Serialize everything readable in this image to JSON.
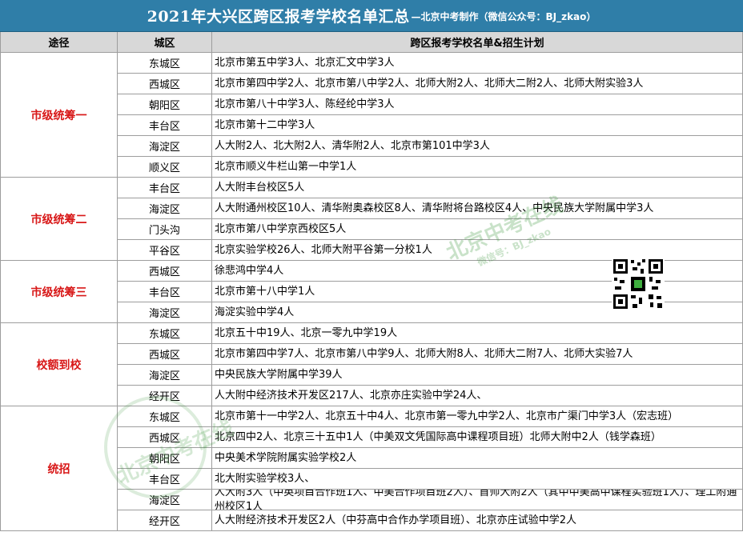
{
  "title": {
    "main": "2021年大兴区跨区报考学校名单汇总",
    "sub": "—北京中考制作（微信公众号：BJ_zkao）"
  },
  "headers": {
    "route": "途径",
    "district": "城区",
    "list": "跨区报考学校名单&招生计划"
  },
  "groups": [
    {
      "route": "市级统筹一",
      "rows": [
        {
          "district": "东城区",
          "schools": "北京市第五中学3人、北京汇文中学3人"
        },
        {
          "district": "西城区",
          "schools": "北京市第四中学2人、北京市第八中学2人、北师大附2人、北师大二附2人、北师大附实验3人"
        },
        {
          "district": "朝阳区",
          "schools": "北京市第八十中学3人、陈经纶中学3人"
        },
        {
          "district": "丰台区",
          "schools": "北京市第十二中学3人"
        },
        {
          "district": "海淀区",
          "schools": "人大附2人、北大附2人、清华附2人、北京市第101中学3人"
        },
        {
          "district": "顺义区",
          "schools": "北京市顺义牛栏山第一中学1人"
        }
      ]
    },
    {
      "route": "市级统筹二",
      "rows": [
        {
          "district": "丰台区",
          "schools": "人大附丰台校区5人"
        },
        {
          "district": "海淀区",
          "schools": "人大附通州校区10人、清华附奥森校区8人、清华附将台路校区4人、中央民族大学附属中学3人"
        },
        {
          "district": "门头沟",
          "schools": "北京市第八中学京西校区5人"
        },
        {
          "district": "平谷区",
          "schools": "北京实验学校26人、北师大附平谷第一分校1人"
        }
      ]
    },
    {
      "route": "市级统筹三",
      "rows": [
        {
          "district": "西城区",
          "schools": "徐悲鸿中学4人"
        },
        {
          "district": "丰台区",
          "schools": "北京市第十八中学1人"
        },
        {
          "district": "海淀区",
          "schools": "海淀实验中学4人"
        }
      ]
    },
    {
      "route": "校额到校",
      "rows": [
        {
          "district": "东城区",
          "schools": "北京五十中19人、北京一零九中学19人"
        },
        {
          "district": "西城区",
          "schools": "北京市第四中学7人、北京市第八中学9人、北师大附8人、北师大二附7人、北师大实验7人"
        },
        {
          "district": "海淀区",
          "schools": "中央民族大学附属中学39人"
        },
        {
          "district": "经开区",
          "schools": "人大附中经济技术开发区217人、北京亦庄实验中学24人、"
        }
      ]
    },
    {
      "route": "统招",
      "rows": [
        {
          "district": "东城区",
          "schools": "北京市第十一中学2人、北京五十中4人、北京市第一零九中学2人、北京市广渠门中学3人（宏志班）"
        },
        {
          "district": "西城区",
          "schools": "北京四中2人、北京三十五中1人（中美双文凭国际高中课程项目班）北师大附中2人（钱学森班）"
        },
        {
          "district": "朝阳区",
          "schools": "中央美术学院附属实验学校2人"
        },
        {
          "district": "丰台区",
          "schools": "北大附实验学校3人、"
        },
        {
          "district": "海淀区",
          "schools": "人大附3人（中英项目合作班1人、中美合作项目班2人）、首师大附2人（其中中美高中课程实验班1人）、理工附通州校区1人"
        },
        {
          "district": "经开区",
          "schools": "人大附经济技术开发区2人（中芬高中合作办学项目班）、北京亦庄试验中学2人"
        }
      ]
    }
  ],
  "watermark": {
    "text": "北京中考在线",
    "sub": "微信号：BJ_zkao"
  },
  "colors": {
    "title_bg": "#2f7ea8",
    "header_bg": "#d8d8d8",
    "route_text": "#d81818",
    "watermark": "#3c963c"
  }
}
